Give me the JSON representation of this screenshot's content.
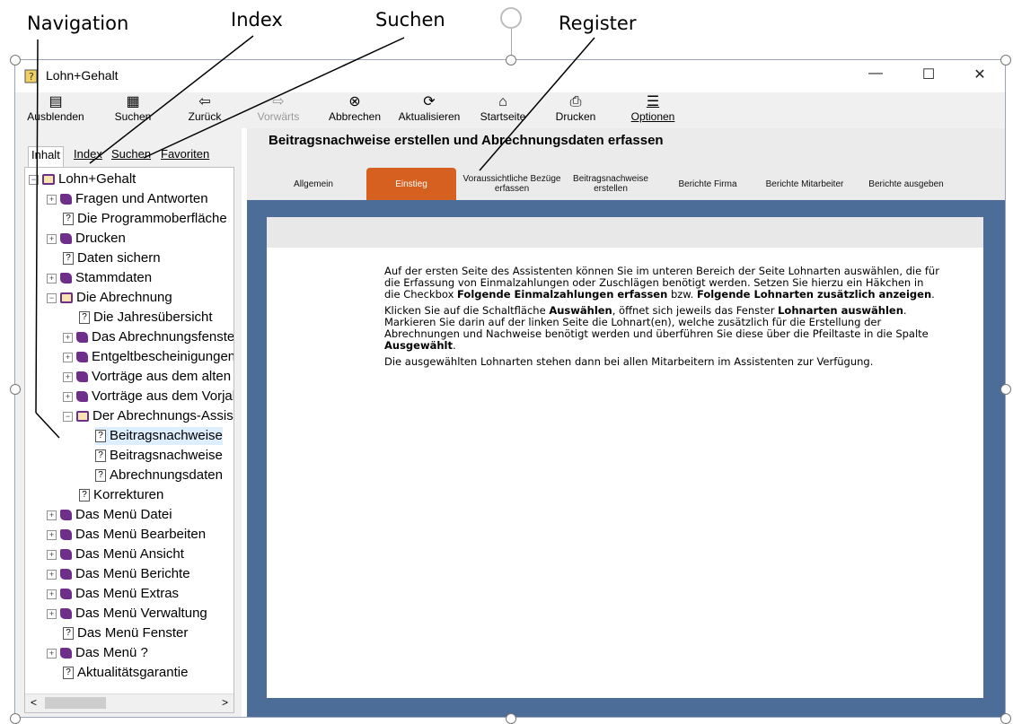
{
  "callouts": {
    "navigation": "Navigation",
    "index": "Index",
    "suchen": "Suchen",
    "register": "Register"
  },
  "window": {
    "title": "Lohn+Gehalt",
    "minimize": "—",
    "maximize": "☐",
    "close": "✕"
  },
  "toolbar": {
    "ausblenden": "Ausblenden",
    "suchen": "Suchen",
    "zurueck": "Zurück",
    "vorwaerts": "Vorwärts",
    "abbrechen": "Abbrechen",
    "aktualisieren": "Aktualisieren",
    "startseite": "Startseite",
    "drucken": "Drucken",
    "optionen": "Optionen"
  },
  "tabs": {
    "inhalt": "Inhalt",
    "index": "Index",
    "suchen": "Suchen",
    "favoriten": "Favoriten"
  },
  "tree": {
    "items": [
      "Lohn+Gehalt",
      "Fragen und Antworten",
      "Die Programmoberfläche",
      "Drucken",
      "Daten sichern",
      "Stammdaten",
      "Die Abrechnung",
      "Die Jahresübersicht",
      "Das Abrechnungsfenster",
      "Entgeltbescheinigungen",
      "Vorträge aus dem alten",
      "Vorträge aus dem Vorjahr",
      "Der Abrechnungs-Assistent",
      "Beitragsnachweise",
      "Beitragsnachweise",
      "Abrechnungsdaten",
      "Korrekturen",
      "Das Menü Datei",
      "Das Menü Bearbeiten",
      "Das Menü Ansicht",
      "Das Menü Berichte",
      "Das Menü Extras",
      "Das Menü Verwaltung",
      "Das Menü Fenster",
      "Das Menü ?",
      "Aktualitätsgarantie"
    ]
  },
  "scrollbar": {
    "left": "<",
    "right": ">"
  },
  "doc": {
    "title": "Beitragsnachweise erstellen und Abrechnungsdaten erfassen",
    "register_tabs": [
      "Allgemein",
      "Einstieg",
      "Voraussichtliche Bezüge erfassen",
      "Beitragsnachweise erstellen",
      "Berichte Firma",
      "Berichte Mitarbeiter",
      "Berichte ausgeben"
    ],
    "p1_a": "Auf der ersten Seite des Assistenten können Sie im unteren Bereich der Seite Lohnarten auswählen, die für die Erfassung von Einmalzahlungen oder Zuschlägen benötigt werden. Setzen Sie hierzu ein Häkchen in die Checkbox ",
    "p1_b": "Folgende Einmalzahlungen erfassen",
    "p1_c": " bzw. ",
    "p1_d": "Folgende Lohnarten zusätzlich anzeigen",
    "p1_e": ".",
    "p2_a": "Klicken Sie auf die Schaltfläche ",
    "p2_b": "Auswählen",
    "p2_c": ", öffnet sich jeweils das Fenster ",
    "p2_d": "Lohnarten auswählen",
    "p2_e": ". Markieren Sie darin auf der linken Seite die Lohnart(en), welche zusätzlich für die Erstellung der Abrechnungen und Nachweise benötigt werden und überführen Sie diese über die Pfeiltaste in die Spalte ",
    "p2_f": "Ausgewählt",
    "p2_g": ".",
    "p3": "Die ausgewählten Lohnarten stehen dann bei allen Mitarbeitern im Assistenten zur Verfügung."
  },
  "colors": {
    "accent_tab": "#d66020",
    "frame_blue": "#4c6d98",
    "book_purple": "#6d2f8a"
  }
}
